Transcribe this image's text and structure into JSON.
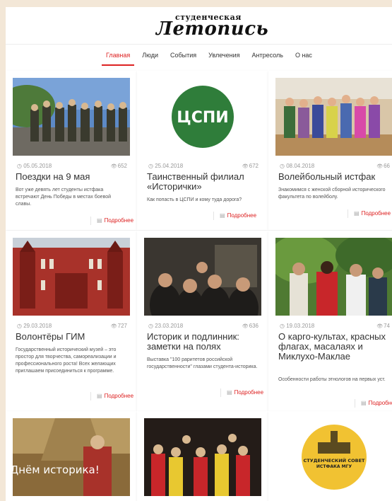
{
  "site": {
    "logo_top": "студенческая",
    "logo_main": "Летопись"
  },
  "nav": [
    "Главная",
    "Люди",
    "События",
    "Увлечения",
    "Антресоль",
    "О нас"
  ],
  "more_label": "Подробнее",
  "cards": [
    {
      "date": "05.05.2018",
      "views": "652",
      "title": "Поездки на 9 мая",
      "desc": "Вот уже девять лет студенты истфака встречают День Победы в местах боевой славы."
    },
    {
      "date": "25.04.2018",
      "views": "672",
      "title": "Таинственный филиал «Исторички»",
      "desc": "Как попасть в ЦСПИ и кому туда дорога?"
    },
    {
      "date": "08.04.2018",
      "views": "66",
      "title": "Волейбольный истфак",
      "desc": "Знакомимся с женской сборной исторического факультета по волейболу."
    },
    {
      "date": "29.03.2018",
      "views": "727",
      "title": "Волонтёры ГИМ",
      "desc": "Государственный исторический музей – это простор для творчества, самореализации и профессионального роста! Всех желающих приглашаем присоединиться к программе."
    },
    {
      "date": "23.03.2018",
      "views": "636",
      "title": "Историк и подлинник: заметки на полях",
      "desc": "Выставка \"100 раритетов российской государственности\" глазами студента-историка."
    },
    {
      "date": "19.03.2018",
      "views": "74",
      "title": "О карго-культах, красных флагах, масалаях и Миклухо-Маклае",
      "desc": "Особенности работы этнологов на первых уст."
    }
  ],
  "thumb_texts": {
    "tspi": "ЦСПИ",
    "historian_day": "С Днём историка!",
    "council_line1": "СТУДЕНЧЕСКИЙ СОВЕТ",
    "council_line2": "ИСТФАКА МГУ"
  }
}
